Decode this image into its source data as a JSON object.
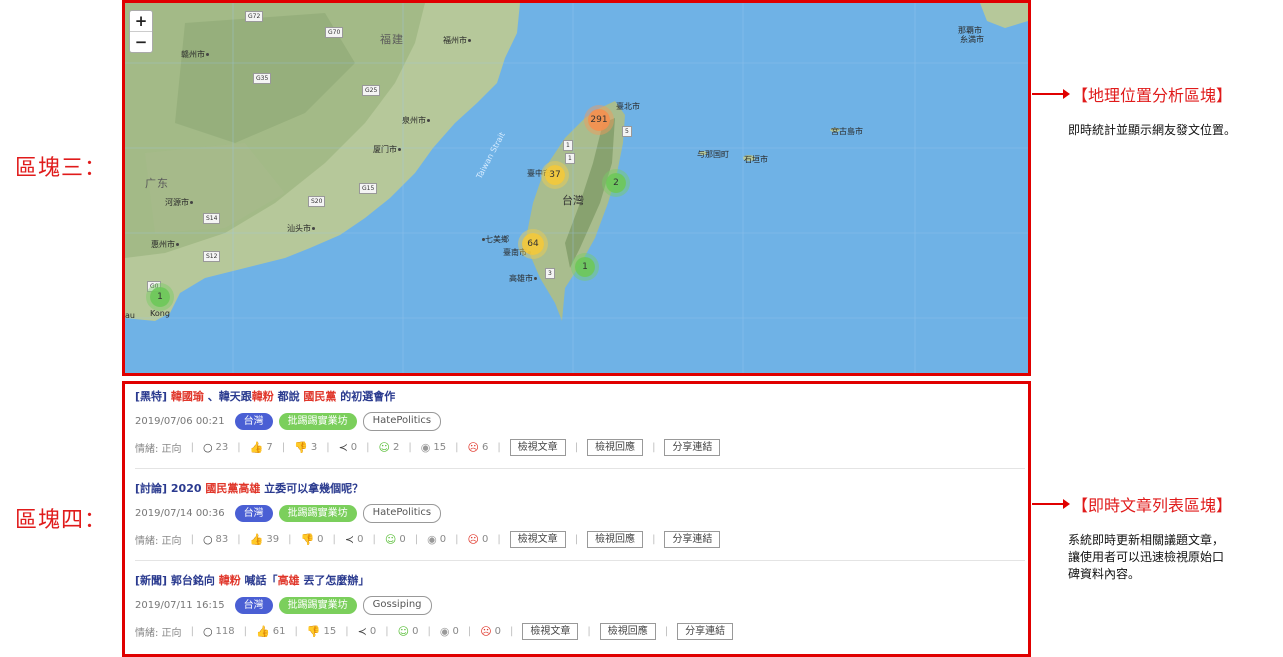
{
  "labels": {
    "block3": "區塊三：",
    "block4": "區塊四："
  },
  "map": {
    "zoom_in": "+",
    "zoom_out": "−",
    "place_names": {
      "fujian": "福建",
      "guangdong": "广东",
      "taiwan": "台灣",
      "taiwan_strait": "Taiwan Strait",
      "ganzhou": "赣州市",
      "fuzhou": "福州市",
      "quanzhou": "泉州市",
      "xiamen": "厦门市",
      "heyuan": "河源市",
      "huizhou": "惠州市",
      "shantou": "汕头市",
      "taipei": "臺北市",
      "taichung": "臺中市",
      "tainan": "臺南市",
      "kaohsiung": "高雄市",
      "penghu": "七美鄉",
      "yonaguni": "与那国町",
      "ishigaki": "石垣市",
      "miyakojima": "宮古島市",
      "naha": "那覇市",
      "yaeyama": "糸満市",
      "hk_left": "au",
      "hk": "Kong"
    },
    "roads": [
      "G72",
      "G70",
      "G35",
      "G25",
      "G15",
      "S20",
      "S14",
      "S12",
      "1",
      "3",
      "5",
      "1",
      "G0"
    ],
    "clusters": [
      {
        "count": "291",
        "color": "orange"
      },
      {
        "count": "37",
        "color": "yellow"
      },
      {
        "count": "2",
        "color": "green"
      },
      {
        "count": "64",
        "color": "yellow"
      },
      {
        "count": "1",
        "color": "green"
      },
      {
        "count": "1",
        "color": "green"
      }
    ]
  },
  "articles": [
    {
      "title_parts": [
        {
          "text": "[黑特] ",
          "hl": false
        },
        {
          "text": "韓國瑜",
          "hl": true
        },
        {
          "text": " 、韓天跟",
          "hl": false
        },
        {
          "text": "韓粉",
          "hl": true
        },
        {
          "text": " 都說 ",
          "hl": false
        },
        {
          "text": "國民黨",
          "hl": true
        },
        {
          "text": " 的初選會作",
          "hl": false
        }
      ],
      "datetime": "2019/07/06 00:21",
      "tags": [
        "台灣",
        "批踢踢實業坊",
        "HatePolitics"
      ],
      "sentiment": "情緒: 正向",
      "comments": "23",
      "likes": "7",
      "dislikes": "3",
      "shares": "0",
      "positive": "2",
      "neutral": "15",
      "negative": "6"
    },
    {
      "title_parts": [
        {
          "text": "[討論] 2020 ",
          "hl": false
        },
        {
          "text": "國民黨",
          "hl": true
        },
        {
          "text": "高雄",
          "hl": true
        },
        {
          "text": " 立委可以拿幾個呢？",
          "hl": false
        }
      ],
      "datetime": "2019/07/14 00:36",
      "tags": [
        "台灣",
        "批踢踢實業坊",
        "HatePolitics"
      ],
      "sentiment": "情緒: 正向",
      "comments": "83",
      "likes": "39",
      "dislikes": "0",
      "shares": "0",
      "positive": "0",
      "neutral": "0",
      "negative": "0"
    },
    {
      "title_parts": [
        {
          "text": "[新聞] 郭台銘向 ",
          "hl": false
        },
        {
          "text": "韓粉",
          "hl": true
        },
        {
          "text": " 喊話「",
          "hl": false
        },
        {
          "text": "高雄",
          "hl": true
        },
        {
          "text": " 丟了怎麼辦」",
          "hl": false
        }
      ],
      "datetime": "2019/07/11 16:15",
      "tags": [
        "台灣",
        "批踢踢實業坊",
        "Gossiping"
      ],
      "sentiment": "情緒: 正向",
      "comments": "118",
      "likes": "61",
      "dislikes": "15",
      "shares": "0",
      "positive": "0",
      "neutral": "0",
      "negative": "0"
    }
  ],
  "buttons": {
    "view_article": "檢視文章",
    "view_replies": "檢視回應",
    "share_link": "分享連結"
  },
  "annotations": {
    "geo_title": "【地理位置分析區塊】",
    "geo_desc": "即時統計並顯示網友發文位置。",
    "list_title": "【即時文章列表區塊】",
    "list_desc_lines": [
      "系統即時更新相關議題文章，",
      "讓使用者可以迅速檢視原始口",
      "碑資料內容。"
    ]
  },
  "colors": {
    "frame": "#e00000",
    "annotation": "#e01b1b",
    "sea": "#6fb2e6",
    "title": "#2a3a8f",
    "highlight": "#e0362a",
    "tag_blue": "#4a5fd4",
    "tag_green": "#7bcf5c"
  }
}
